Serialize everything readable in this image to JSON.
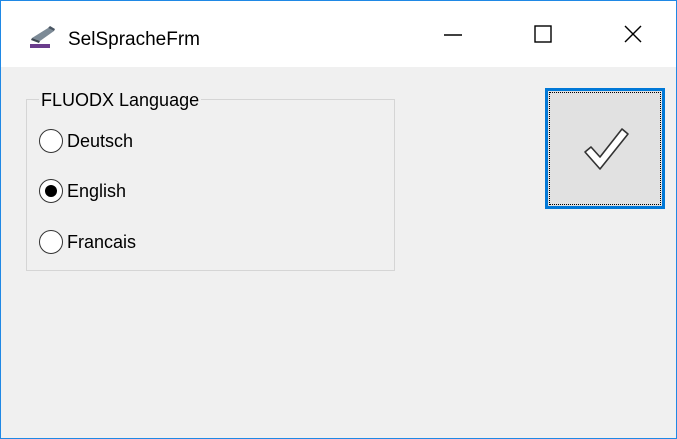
{
  "window": {
    "title": "SelSpracheFrm",
    "app_icon": "app-icon",
    "controls": [
      "minimize-icon",
      "maximize-icon",
      "close-icon"
    ]
  },
  "language_group": {
    "legend": "FLUODX Language",
    "options": [
      {
        "label": "Deutsch",
        "selected": false
      },
      {
        "label": "English",
        "selected": true
      },
      {
        "label": "Francais",
        "selected": false
      }
    ]
  },
  "ok_button": {
    "icon": "checkmark-icon"
  },
  "colors": {
    "accent": "#0078d7",
    "window_bg": "#f0f0f0",
    "titlebar_bg": "#ffffff"
  }
}
